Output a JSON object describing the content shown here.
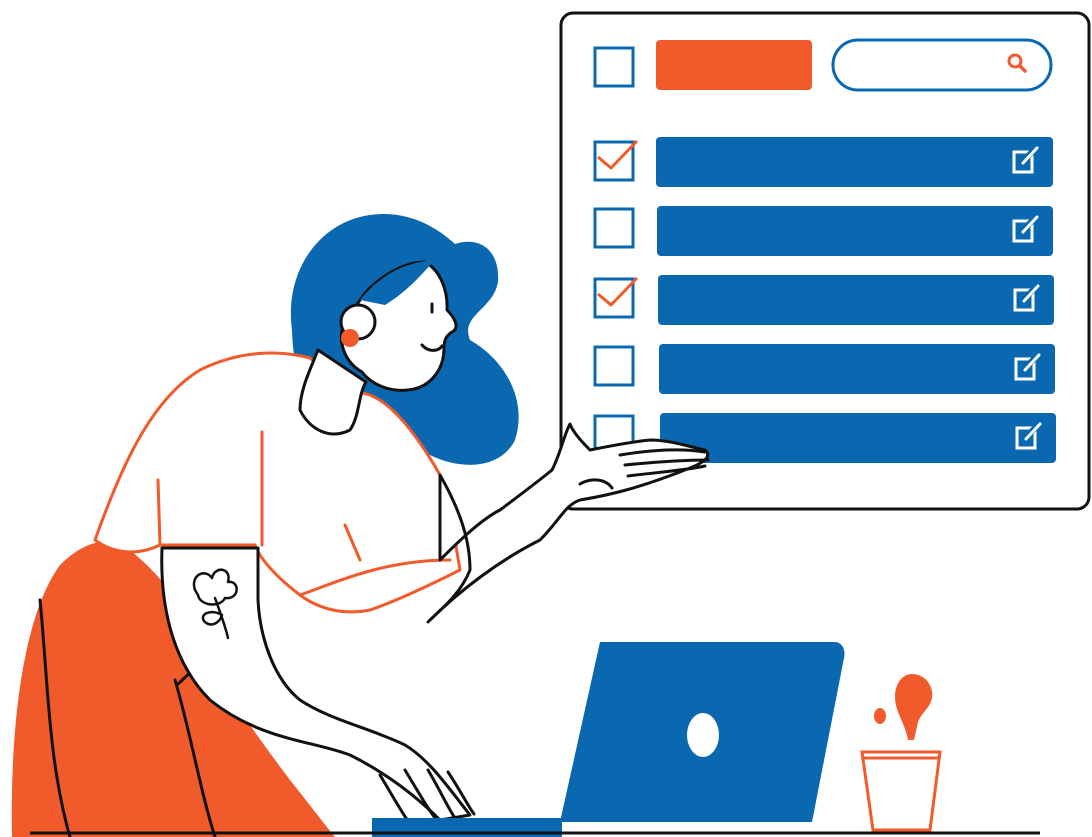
{
  "illustration": {
    "colors": {
      "blue": "#0a68b0",
      "orange": "#f15a2b",
      "black": "#111111",
      "white": "#ffffff"
    },
    "panel": {
      "header": {
        "select_all_checked": false,
        "action_button_color": "#f15a2b",
        "search_icon": "search-icon"
      },
      "rows": [
        {
          "checked": true,
          "edit_icon": "edit-icon"
        },
        {
          "checked": false,
          "edit_icon": "edit-icon"
        },
        {
          "checked": true,
          "edit_icon": "edit-icon"
        },
        {
          "checked": false,
          "edit_icon": "edit-icon"
        },
        {
          "checked": false,
          "edit_icon": "edit-icon"
        }
      ]
    },
    "figures": [
      "woman-figure",
      "laptop",
      "cup-with-drop"
    ]
  }
}
